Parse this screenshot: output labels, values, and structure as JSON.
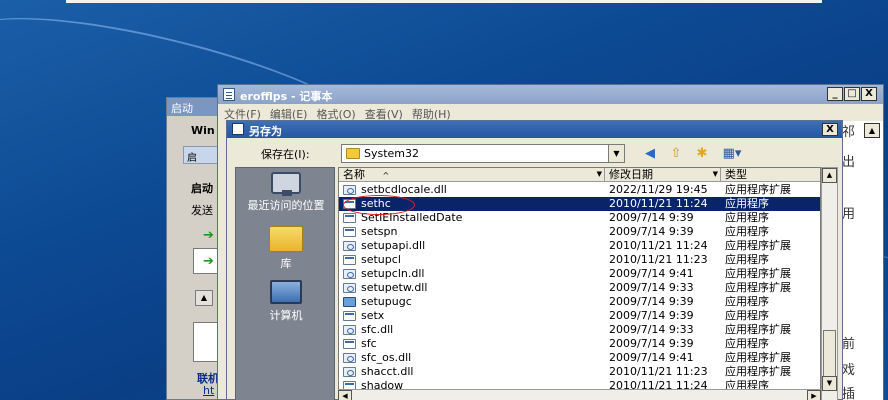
{
  "background_window": {
    "title": "启动",
    "line1": "Win",
    "tab": "启",
    "heading": "启动",
    "subtext": "发送",
    "link1": "联机",
    "link2": "ht"
  },
  "notepad": {
    "title": "erofflps - 记事本",
    "menu": [
      "文件(F)",
      "编辑(E)",
      "格式(O)",
      "查看(V)",
      "帮助(H)"
    ],
    "minimize": "_",
    "maximize": "□",
    "close": "X",
    "edge_text": [
      "祁",
      "出",
      "用",
      "前",
      "戏",
      "插"
    ]
  },
  "dialog": {
    "title": "另存为",
    "close": "X",
    "save_in_label": "保存在(I):",
    "folder": "System32",
    "places": [
      {
        "label": "最近访问的位置",
        "icon": "recent-places-icon"
      },
      {
        "label": "库",
        "icon": "library-icon"
      },
      {
        "label": "计算机",
        "icon": "computer-icon"
      }
    ],
    "columns": {
      "name": "名称",
      "date": "修改日期",
      "type": "类型"
    },
    "sort_glyph": "^",
    "files": [
      {
        "name": "setbcdlocale.dll",
        "date": "2022/11/29 19:45",
        "type": "应用程序扩展",
        "kind": "dll"
      },
      {
        "name": "sethc",
        "date": "2010/11/21 11:24",
        "type": "应用程序",
        "kind": "exe",
        "selected": true
      },
      {
        "name": "SetIEInstalledDate",
        "date": "2009/7/14 9:39",
        "type": "应用程序",
        "kind": "exe"
      },
      {
        "name": "setspn",
        "date": "2009/7/14 9:39",
        "type": "应用程序",
        "kind": "exe"
      },
      {
        "name": "setupapi.dll",
        "date": "2010/11/21 11:24",
        "type": "应用程序扩展",
        "kind": "dll"
      },
      {
        "name": "setupcl",
        "date": "2010/11/21 11:23",
        "type": "应用程序",
        "kind": "exe"
      },
      {
        "name": "setupcln.dll",
        "date": "2009/7/14 9:41",
        "type": "应用程序扩展",
        "kind": "dll"
      },
      {
        "name": "setupetw.dll",
        "date": "2009/7/14 9:33",
        "type": "应用程序扩展",
        "kind": "dll"
      },
      {
        "name": "setupugc",
        "date": "2009/7/14 9:39",
        "type": "应用程序",
        "kind": "ugc"
      },
      {
        "name": "setx",
        "date": "2009/7/14 9:39",
        "type": "应用程序",
        "kind": "exe"
      },
      {
        "name": "sfc.dll",
        "date": "2009/7/14 9:33",
        "type": "应用程序扩展",
        "kind": "dll"
      },
      {
        "name": "sfc",
        "date": "2009/7/14 9:39",
        "type": "应用程序",
        "kind": "exe"
      },
      {
        "name": "sfc_os.dll",
        "date": "2009/7/14 9:41",
        "type": "应用程序扩展",
        "kind": "dll"
      },
      {
        "name": "shacct.dll",
        "date": "2010/11/21 11:23",
        "type": "应用程序扩展",
        "kind": "dll"
      },
      {
        "name": "shadow",
        "date": "2010/11/21 11:24",
        "type": "应用程序",
        "kind": "exe"
      }
    ]
  }
}
